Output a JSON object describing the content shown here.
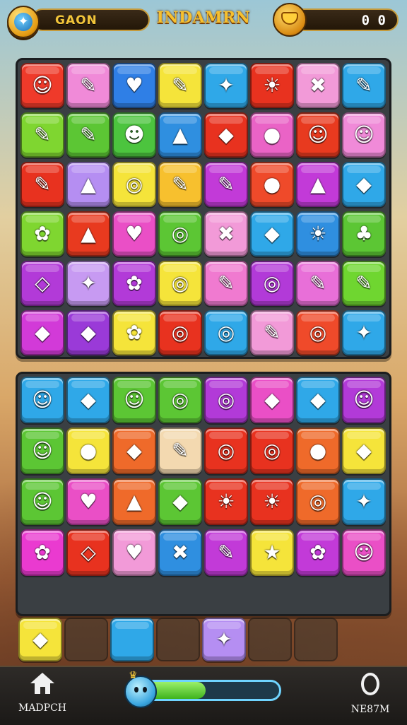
{
  "header": {
    "left_label": "GAON",
    "title": "INDAMRN",
    "score": "0 0"
  },
  "board1": {
    "rows": [
      [
        [
          "#ef3a2a",
          "☺"
        ],
        [
          "#f08ad8",
          "✎"
        ],
        [
          "#2f7fe6",
          "♥"
        ],
        [
          "#f5e43a",
          "✎"
        ],
        [
          "#2fa8e8",
          "✦"
        ],
        [
          "#e8321f",
          "☀"
        ],
        [
          "#f29ad8",
          "✖"
        ],
        [
          "#2fa8e8",
          "✎"
        ]
      ],
      [
        [
          "#7fd630",
          "✎"
        ],
        [
          "#5cc634",
          "✎"
        ],
        [
          "#4cc43e",
          "☻"
        ],
        [
          "#2f8fe0",
          "▲"
        ],
        [
          "#e8321f",
          "◆"
        ],
        [
          "#ea63c6",
          "●"
        ],
        [
          "#e83a1f",
          "☺"
        ],
        [
          "#f08ad8",
          "☺"
        ]
      ],
      [
        [
          "#e8321f",
          "✎"
        ],
        [
          "#b58ef2",
          "▲"
        ],
        [
          "#f5e43a",
          "◎"
        ],
        [
          "#f7c02e",
          "✎"
        ],
        [
          "#c23ad8",
          "✎"
        ],
        [
          "#ef4a2a",
          "●"
        ],
        [
          "#c23ad8",
          "▲"
        ],
        [
          "#2fa8e8",
          "◆"
        ]
      ],
      [
        [
          "#7fd630",
          "✿"
        ],
        [
          "#e83a1f",
          "▲"
        ],
        [
          "#ea4fc6",
          "♥"
        ],
        [
          "#5cc634",
          "◎"
        ],
        [
          "#f29ad8",
          "✖"
        ],
        [
          "#2fa8e8",
          "◆"
        ],
        [
          "#2f8fe0",
          "☀"
        ],
        [
          "#5cc634",
          "♣"
        ]
      ],
      [
        [
          "#b23ad8",
          "◇"
        ],
        [
          "#c79af2",
          "✦"
        ],
        [
          "#b23ad8",
          "✿"
        ],
        [
          "#f5e43a",
          "◎"
        ],
        [
          "#f07ad0",
          "✎"
        ],
        [
          "#b23ad8",
          "◎"
        ],
        [
          "#e86fd8",
          "✎"
        ],
        [
          "#6fd630",
          "✎"
        ]
      ],
      [
        [
          "#d23ad8",
          "◆"
        ],
        [
          "#9a3ad8",
          "◆"
        ],
        [
          "#f5e43a",
          "✿"
        ],
        [
          "#e8321f",
          "◎"
        ],
        [
          "#2fa8e8",
          "◎"
        ],
        [
          "#f29ad8",
          "✎"
        ],
        [
          "#ef4a2a",
          "◎"
        ],
        [
          "#2fa8e8",
          "✦"
        ]
      ]
    ]
  },
  "board2": {
    "rows": [
      [
        [
          "#2fa8e8",
          "☺"
        ],
        [
          "#2fa8e8",
          "◆"
        ],
        [
          "#5cc634",
          "☺"
        ],
        [
          "#5cc634",
          "◎"
        ],
        [
          "#b23ad8",
          "◎"
        ],
        [
          "#ea4fc6",
          "◆"
        ],
        [
          "#2fa8e8",
          "◆"
        ],
        [
          "#b23ad8",
          "☺"
        ]
      ],
      [
        [
          "#5cc634",
          "☺"
        ],
        [
          "#f5e43a",
          "●"
        ],
        [
          "#ef6a2a",
          "◆"
        ],
        [
          "#f3d9b0",
          "✎"
        ],
        [
          "#e8321f",
          "◎"
        ],
        [
          "#e8321f",
          "◎"
        ],
        [
          "#ef6a2a",
          "●"
        ],
        [
          "#f5e43a",
          "◆"
        ]
      ],
      [
        [
          "#5cc634",
          "☺"
        ],
        [
          "#ea4fc6",
          "♥"
        ],
        [
          "#ef6a2a",
          "▲"
        ],
        [
          "#5cc634",
          "◆"
        ],
        [
          "#e8321f",
          "☀"
        ],
        [
          "#e8321f",
          "☀"
        ],
        [
          "#ef6a2a",
          "◎"
        ],
        [
          "#2fa8e8",
          "✦"
        ]
      ],
      [
        [
          "#ea3ad0",
          "✿"
        ],
        [
          "#e8321f",
          "◇"
        ],
        [
          "#f29ad8",
          "♥"
        ],
        [
          "#2f8fe0",
          "✖"
        ],
        [
          "#c23ad8",
          "✎"
        ],
        [
          "#f5e43a",
          "★"
        ],
        [
          "#c23ad8",
          "✿"
        ],
        [
          "#ea4fc6",
          "☺"
        ]
      ],
      [
        [
          "#9a3ad8",
          "✦"
        ],
        [
          "#e8321f",
          "✎"
        ],
        [
          "#f5e43a",
          "☀"
        ],
        [
          "#f7c02e",
          "◎"
        ],
        [
          "#5cc634",
          "✎"
        ],
        [
          "#5cc634",
          "✺"
        ],
        [
          "#6a6a6a",
          "✎"
        ],
        [
          "#5cc634",
          "♣"
        ]
      ]
    ]
  },
  "tray": [
    {
      "color": "#f5e43a",
      "icon": "◆"
    },
    {
      "color": "",
      "icon": ""
    },
    {
      "color": "#2fa8e8",
      "icon": ""
    },
    {
      "color": "",
      "icon": ""
    },
    {
      "color": "#b58ef2",
      "icon": "✦"
    },
    {
      "color": "",
      "icon": ""
    },
    {
      "color": "",
      "icon": ""
    }
  ],
  "progress": {
    "fraction": 0.45
  },
  "footer": {
    "left_label": "MADPCH",
    "right_label": "NE87M"
  },
  "colors": {
    "accent_gold": "#f6c02f",
    "board_bg": "#3a3f43",
    "progress_fill": "#3fb31d",
    "progress_border": "#6fd4ff"
  }
}
